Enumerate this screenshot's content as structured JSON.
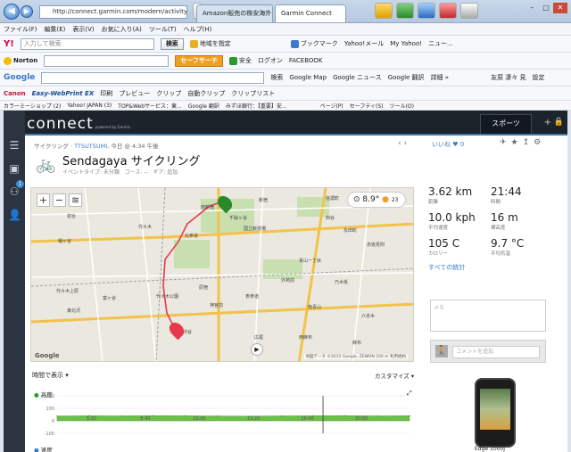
{
  "browser": {
    "url": "http://connect.garmin.com/modern/activity/",
    "tabs": [
      "Amazon販売の株安海外マッ...",
      "Garmin Connect"
    ],
    "menu": [
      "ファイル(F)",
      "編集(E)",
      "表示(V)",
      "お気に入り(A)",
      "ツール(T)",
      "ヘルプ(H)"
    ],
    "yahoo_bar": {
      "placeholder": "入力して検索",
      "search_btn": "検索",
      "items": [
        "地域を指定",
        "ブックマーク",
        "Yahoo!メール",
        "My Yahoo!",
        "ニュー..."
      ]
    },
    "norton_bar": {
      "label": "Norton",
      "safe_search": "セーフサーチ",
      "status": "安全",
      "items": [
        "ログオン",
        "FACEBOOK"
      ]
    },
    "google_bar": {
      "label": "Google",
      "items": [
        "検索",
        "Google Map",
        "Google ニュース",
        "Google 翻訳",
        "詳細 »"
      ],
      "user": "友原 凄々 見",
      "settings": "設定"
    },
    "canon_bar": {
      "label": "Canon",
      "product": "Easy-WebPrint EX",
      "items": [
        "印刷",
        "プレビュー",
        "クリップ",
        "自動クリップ",
        "クリップリスト"
      ]
    },
    "fav_bar": {
      "items": [
        "カラーミーショップ (2)",
        "Yahoo! JAPAN (3)",
        "TOP&Webサービス：東...",
        "Google 翻訳",
        "みずほ銀行：【重要】安..."
      ],
      "right": [
        "ページ(P)",
        "セーフティ(S)",
        "ツール(O)"
      ]
    }
  },
  "app": {
    "logo": "connect",
    "logo_sub": "powered by Garmin",
    "sports_tab": "スポーツ",
    "badge": "1",
    "activity": {
      "breadcrumb_type": "サイクリング",
      "user": "TTSUTSUMI",
      "time": "今日 @ 4:34 午後",
      "title": "Sendagaya サイクリング",
      "event_type": "イベントタイプ: 未分類",
      "course": "コース: --",
      "gear": "ギア: 追加",
      "likes": "いいね",
      "like_count": "0"
    },
    "weather": {
      "temp": "8.9°",
      "wind": "23"
    },
    "map": {
      "copyright": "地図データ ©2015 Google, ZENRIN",
      "scale": "500 m",
      "terms": "利用規約",
      "google": "Google",
      "labels": [
        "南新宿",
        "北参道",
        "代々木",
        "新宿",
        "千駄ヶ谷",
        "国立競技場",
        "信濃町",
        "初台",
        "幡ヶ谷",
        "代々木上原",
        "代々木公園",
        "原宿",
        "神宮前",
        "表参道",
        "渋谷",
        "東北沢",
        "富ヶ谷",
        "青山一丁目",
        "外苑前",
        "乃木坂",
        "六本木",
        "麻布",
        "赤坂見附",
        "永田町",
        "南青山",
        "四谷",
        "西麻布",
        "広尾"
      ]
    },
    "stats": [
      {
        "value": "3.62 km",
        "label": "距離"
      },
      {
        "value": "21:44",
        "label": "時間"
      },
      {
        "value": "10.0 kph",
        "label": "平均速度"
      },
      {
        "value": "16 m",
        "label": "標高差"
      },
      {
        "value": "105 C",
        "label": "カロリー"
      },
      {
        "value": "9.7 °C",
        "label": "平均気温"
      }
    ],
    "all_stats": "すべての統計",
    "memo_placeholder": "メモ",
    "comment_placeholder": "コメントを追加",
    "time_display": "時間で表示",
    "customize": "カスタマイズ",
    "elevation_label": "高度",
    "speed_label": "速度",
    "device_name": "Edge 1000J",
    "chart_y_ticks": [
      "200",
      "100",
      "0",
      "-100"
    ],
    "chart_x_ticks": [
      "3:20",
      "6:40",
      "10:00",
      "13:20",
      "16:40",
      "20:00"
    ]
  },
  "chart_data": {
    "type": "area",
    "title": "",
    "ylabel": "",
    "ylim": [
      -100,
      200
    ],
    "x": [
      0,
      2,
      4,
      6,
      8,
      10,
      12,
      14,
      16,
      18,
      20,
      22
    ],
    "series": [
      {
        "name": "高度",
        "values": [
          38,
          40,
          39,
          41,
          40,
          38,
          37,
          39,
          40,
          41,
          39,
          40
        ]
      }
    ]
  }
}
